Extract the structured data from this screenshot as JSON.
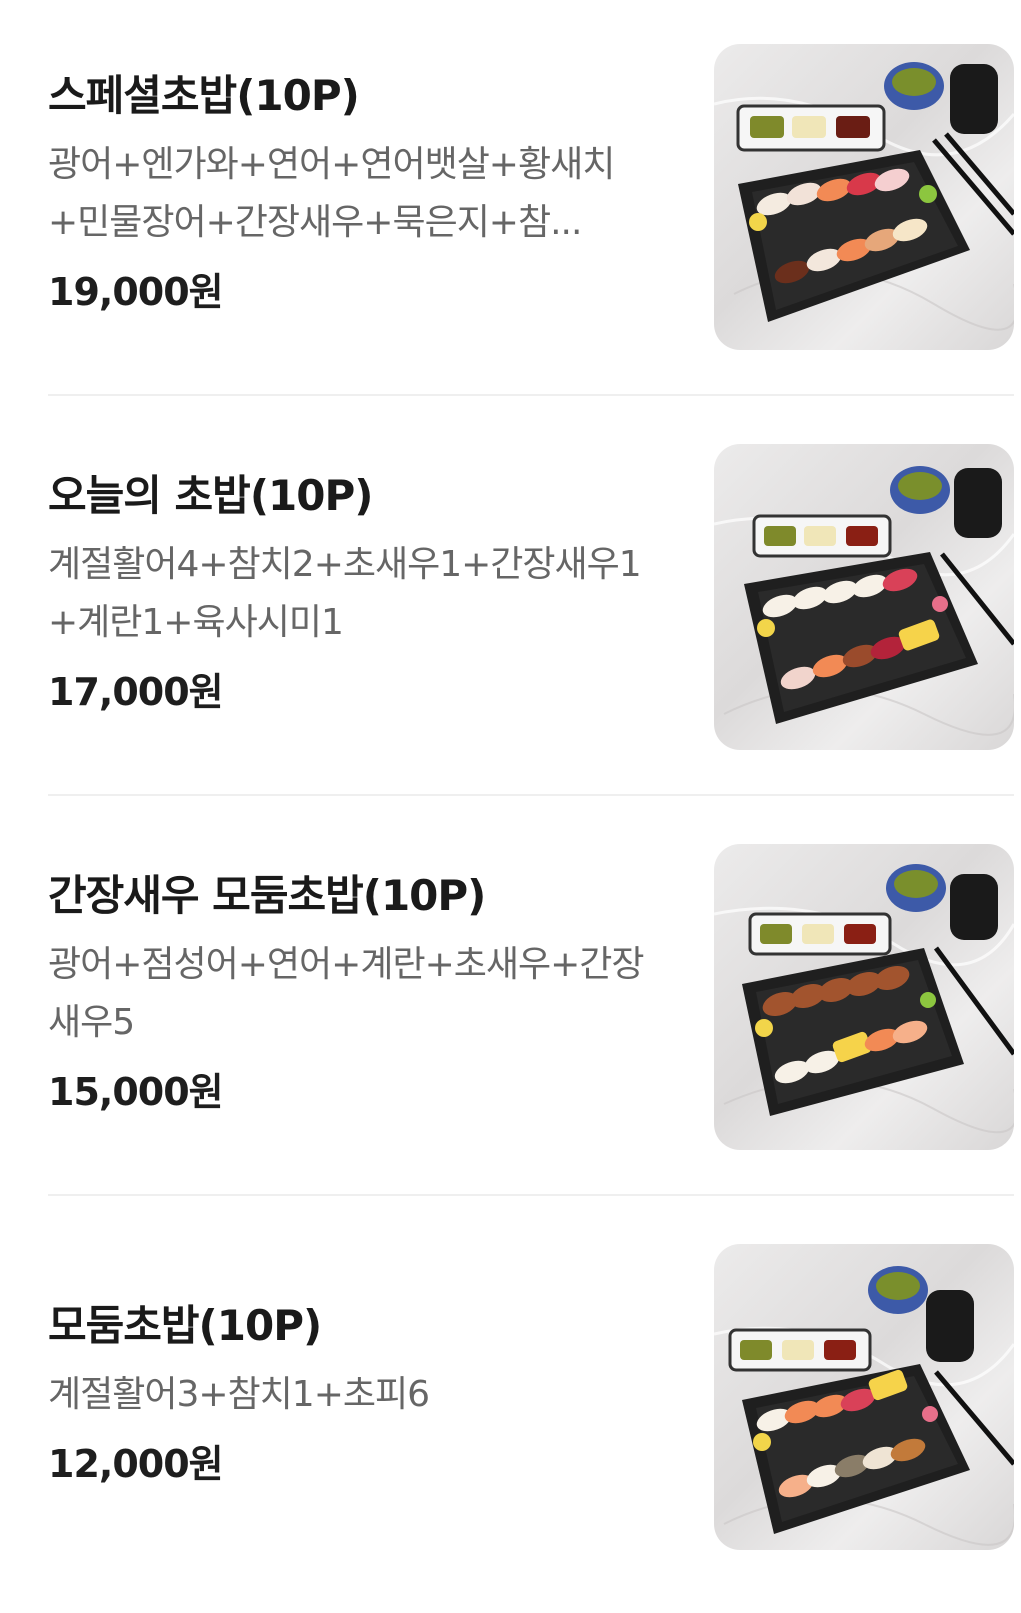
{
  "menu_items": [
    {
      "title": "스페셜초밥(10P)",
      "description": "광어+엔가와+연어+연어뱃살+황새치+민물장어+간장새우+묵은지+참...",
      "price": "19,000원",
      "image_icon": "sushi-platter-image"
    },
    {
      "title": "오늘의 초밥(10P)",
      "description": "계절활어4+참치2+초새우1+간장새우1+계란1+육사시미1",
      "price": "17,000원",
      "image_icon": "sushi-platter-image"
    },
    {
      "title": "간장새우 모둠초밥(10P)",
      "description": "광어+점성어+연어+계란+초새우+간장새우5",
      "price": "15,000원",
      "image_icon": "sushi-platter-image"
    },
    {
      "title": "모둠초밥(10P)",
      "description": "계절활어3+참치1+초피6",
      "price": "12,000원",
      "image_icon": "sushi-platter-image"
    }
  ],
  "colors": {
    "title": "#1a1a1a",
    "description": "#666666",
    "price": "#1e1e1e",
    "divider": "#efefef",
    "tray": "#1f1f1f"
  }
}
